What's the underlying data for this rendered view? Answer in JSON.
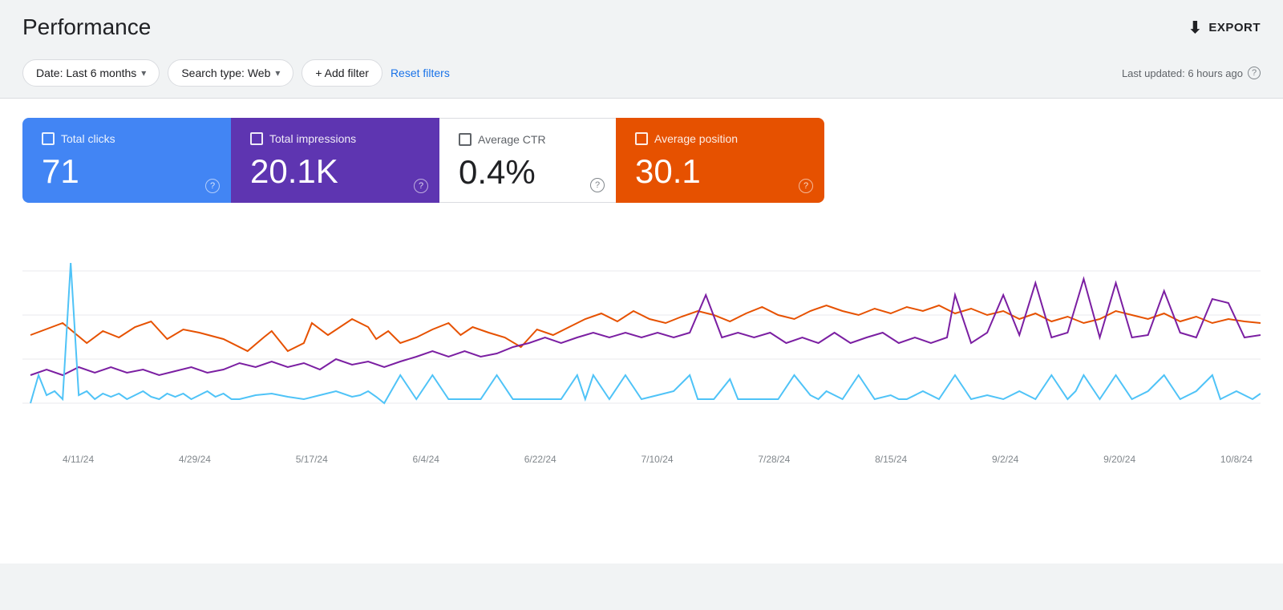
{
  "header": {
    "title": "Performance",
    "export_label": "EXPORT"
  },
  "filters": {
    "date_label": "Date: Last 6 months",
    "search_type_label": "Search type: Web",
    "add_filter_label": "+ Add filter",
    "reset_label": "Reset filters",
    "last_updated": "Last updated: 6 hours ago"
  },
  "metrics": {
    "clicks": {
      "label": "Total clicks",
      "value": "71"
    },
    "impressions": {
      "label": "Total impressions",
      "value": "20.1K"
    },
    "ctr": {
      "label": "Average CTR",
      "value": "0.4%"
    },
    "position": {
      "label": "Average position",
      "value": "30.1"
    }
  },
  "chart": {
    "x_labels": [
      "4/11/24",
      "4/29/24",
      "5/17/24",
      "6/4/24",
      "6/22/24",
      "7/10/24",
      "7/28/24",
      "8/15/24",
      "9/2/24",
      "9/20/24",
      "10/8/24"
    ],
    "colors": {
      "blue": "#4fc3f7",
      "purple": "#7b1fa2",
      "orange": "#e65100"
    }
  }
}
